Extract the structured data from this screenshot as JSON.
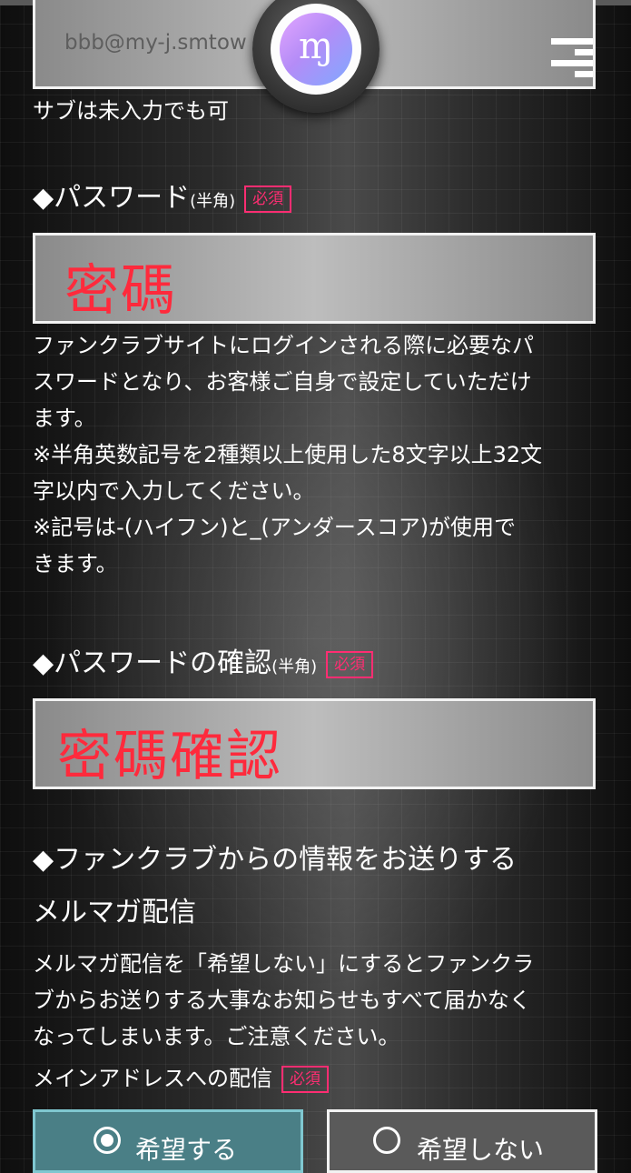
{
  "email_field": {
    "value": "bbb@my-j.smtow"
  },
  "sub_note": "サブは未入力でも可",
  "password": {
    "heading": "◆パスワード",
    "half_width": "(半角)",
    "required": "必須",
    "value": "密碼",
    "description": [
      "ファンクラブサイトにログインされる際に必要なパ",
      "スワードとなり、お客様ご自身で設定していただけ",
      "ます。",
      "※半角英数記号を2種類以上使用した8文字以上32文",
      "字以内で入力してください。",
      "※記号は-(ハイフン)と_(アンダースコア)が使用で",
      "きます。"
    ]
  },
  "password_confirm": {
    "heading": "◆パスワードの確認",
    "half_width": "(半角)",
    "required": "必須",
    "value": "密碼確認"
  },
  "newsletter": {
    "heading_line1": "◆ファンクラブからの情報をお送りする",
    "heading_line2": "メルマガ配信",
    "description": [
      "メルマガ配信を「希望しない」にするとファンクラ",
      "ブからお送りする大事なお知らせもすべて届かなく",
      "なってしまいます。ご注意ください。"
    ],
    "main_address_label": "メインアドレスへの配信",
    "required": "必須",
    "option_yes": "希望する",
    "option_no": "希望しない",
    "selected": "希望する"
  },
  "icons": {
    "logo": "fanclub-logo-icon",
    "handle": "menu-handle-icon"
  },
  "colors": {
    "accent_red": "#ff2a3c",
    "badge_pink": "#ff2d72",
    "selected_teal": "#4a7f86"
  }
}
